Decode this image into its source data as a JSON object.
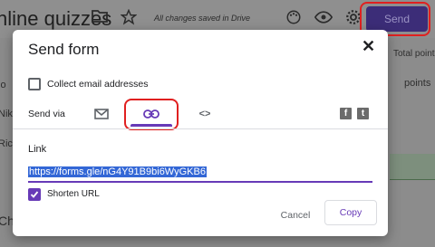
{
  "app": {
    "title": "nline quizzes",
    "saved_status": "All changes saved in Drive",
    "send_label": "Send",
    "total_points": "Total points",
    "points": "points",
    "left_fragments": [
      "lo",
      "Nik",
      "Rich",
      "Ch"
    ]
  },
  "dialog": {
    "title": "Send form",
    "close_glyph": "✕",
    "collect_email_label": "Collect email addresses",
    "send_via_label": "Send via",
    "tabs": [
      "email",
      "link",
      "embed"
    ],
    "active_tab": "link",
    "embed_glyph": "<>",
    "social": [
      "f",
      "t"
    ],
    "link_label": "Link",
    "url": "https://forms.gle/nG4Y91B9bi6WyGKB6",
    "shorten_url_label": "Shorten URL",
    "shorten_url_checked": true,
    "cancel_label": "Cancel",
    "copy_label": "Copy"
  },
  "colors": {
    "accent": "#673ab7",
    "highlight_ring": "#e02020"
  }
}
